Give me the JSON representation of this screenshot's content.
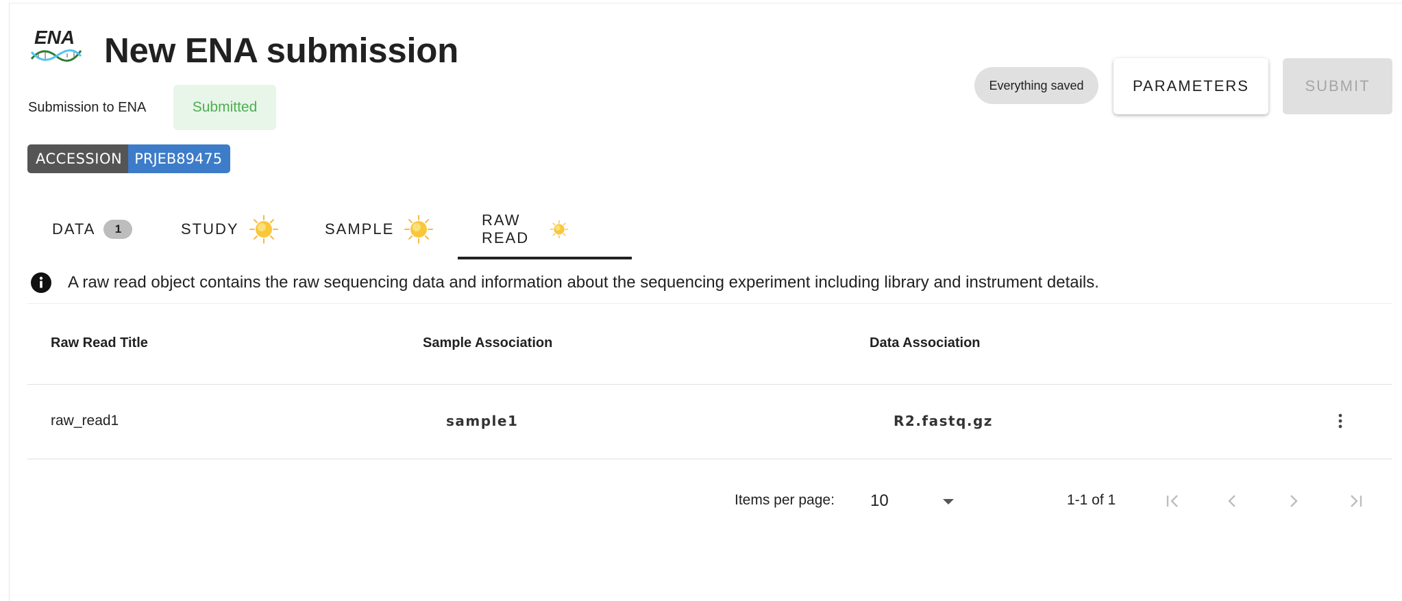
{
  "header": {
    "logo_text": "ENA",
    "title": "New ENA submission",
    "submission_label": "Submission to ENA",
    "status": "Submitted",
    "accession_key": "ACCESSION",
    "accession_value": "PRJEB89475",
    "saved_status": "Everything saved",
    "parameters_label": "PARAMETERS",
    "submit_label": "SUBMIT"
  },
  "tabs": [
    {
      "label": "DATA",
      "badge": "1"
    },
    {
      "label": "STUDY",
      "icon": "sun-icon"
    },
    {
      "label": "SAMPLE",
      "icon": "sun-icon"
    },
    {
      "label": "RAW READ",
      "icon": "sun-icon",
      "active": true
    }
  ],
  "info": {
    "icon": "info-icon",
    "text": "A raw read object contains the raw sequencing data and information about the sequencing experiment including library and instrument details."
  },
  "table": {
    "columns": [
      "Raw Read Title",
      "Sample Association",
      "Data Association"
    ],
    "rows": [
      {
        "title": "raw_read1",
        "sample": "sample1",
        "data": "R2.fastq.gz"
      }
    ]
  },
  "paginator": {
    "items_per_page_label": "Items per page:",
    "page_size": "10",
    "range_label": "1-1 of 1"
  },
  "colors": {
    "accession_key_bg": "#555555",
    "accession_value_bg": "#3d7cc9",
    "status_green": "#4caf50",
    "sun_yellow": "#f9c73a"
  }
}
